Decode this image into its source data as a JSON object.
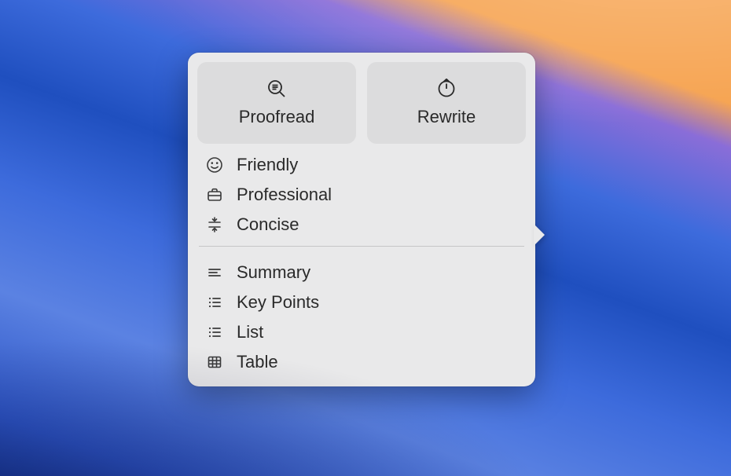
{
  "primary": {
    "proofread": {
      "label": "Proofread"
    },
    "rewrite": {
      "label": "Rewrite"
    }
  },
  "tone_items": {
    "friendly": {
      "label": "Friendly"
    },
    "professional": {
      "label": "Professional"
    },
    "concise": {
      "label": "Concise"
    }
  },
  "format_items": {
    "summary": {
      "label": "Summary"
    },
    "keypoints": {
      "label": "Key Points"
    },
    "list": {
      "label": "List"
    },
    "table": {
      "label": "Table"
    }
  }
}
